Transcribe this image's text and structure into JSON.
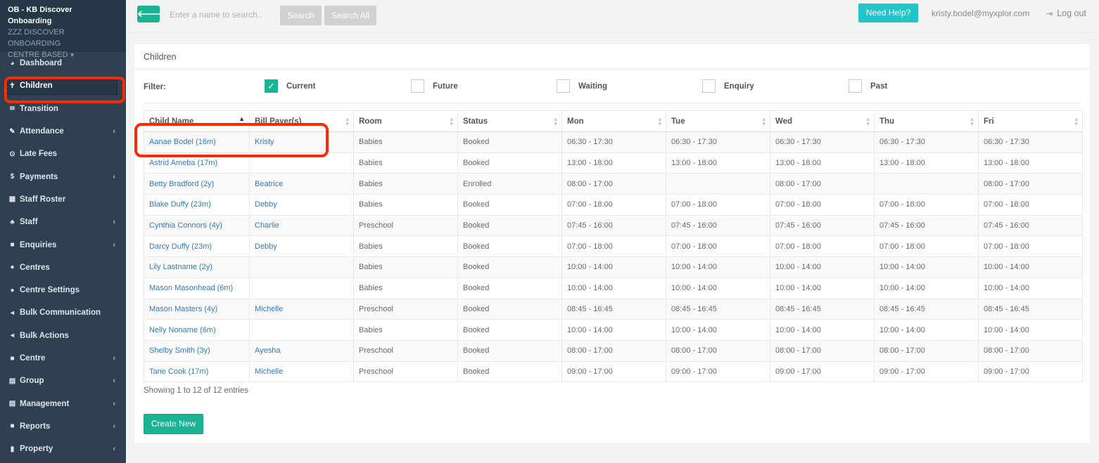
{
  "sidebar": {
    "org_name": "OB - KB Discover Onboarding",
    "centre_line1": "zzz DISCOVER ONBOARDING",
    "centre_line2": "CENTRE BASED",
    "items": [
      {
        "label": "Dashboard",
        "icon": "dashboard-icon",
        "glyph": "◕",
        "chevron": false
      },
      {
        "label": "Children",
        "icon": "child-icon",
        "glyph": "✝",
        "chevron": false,
        "active": true
      },
      {
        "label": "Transition",
        "icon": "graduation-cap-icon",
        "glyph": "≅",
        "chevron": false
      },
      {
        "label": "Attendance",
        "icon": "edit-icon",
        "glyph": "✎",
        "chevron": true
      },
      {
        "label": "Late Fees",
        "icon": "clock-icon",
        "glyph": "⊙",
        "chevron": false
      },
      {
        "label": "Payments",
        "icon": "dollar-icon",
        "glyph": "$",
        "chevron": true
      },
      {
        "label": "Staff Roster",
        "icon": "calendar-icon",
        "glyph": "▦",
        "chevron": false
      },
      {
        "label": "Staff",
        "icon": "sitemap-icon",
        "glyph": "♣",
        "chevron": true
      },
      {
        "label": "Enquiries",
        "icon": "grid-icon",
        "glyph": "■",
        "chevron": true
      },
      {
        "label": "Centres",
        "icon": "circle-icon",
        "glyph": "●",
        "chevron": false
      },
      {
        "label": "Centre Settings",
        "icon": "circle-icon",
        "glyph": "●",
        "chevron": false
      },
      {
        "label": "Bulk Communication",
        "icon": "bullhorn-icon",
        "glyph": "◂",
        "chevron": false
      },
      {
        "label": "Bulk Actions",
        "icon": "bullhorn-icon",
        "glyph": "◂",
        "chevron": false
      },
      {
        "label": "Centre",
        "icon": "grid-icon",
        "glyph": "■",
        "chevron": true
      },
      {
        "label": "Group",
        "icon": "hdd-icon",
        "glyph": "▤",
        "chevron": true
      },
      {
        "label": "Management",
        "icon": "hdd-icon",
        "glyph": "▤",
        "chevron": true
      },
      {
        "label": "Reports",
        "icon": "grid-icon",
        "glyph": "■",
        "chevron": true
      },
      {
        "label": "Property",
        "icon": "building-icon",
        "glyph": "▮",
        "chevron": true
      }
    ]
  },
  "topbar": {
    "search_placeholder": "Enter a name to search..",
    "search_label": "Search",
    "search_all_label": "Search All",
    "need_help_label": "Need Help?",
    "user_email": "kristy.bodel@myxplor.com",
    "logout_label": "Log out"
  },
  "panel": {
    "title": "Children",
    "filter_label": "Filter:",
    "filters": [
      {
        "label": "Current",
        "checked": true
      },
      {
        "label": "Future",
        "checked": false
      },
      {
        "label": "Waiting",
        "checked": false
      },
      {
        "label": "Enquiry",
        "checked": false
      },
      {
        "label": "Past",
        "checked": false
      }
    ]
  },
  "table": {
    "columns": [
      "Child Name",
      "Bill Payer(s)",
      "Room",
      "Status",
      "Mon",
      "Tue",
      "Wed",
      "Thu",
      "Fri"
    ],
    "rows": [
      [
        "Aanae Bodel (16m)",
        "Kristy",
        "Babies",
        "Booked",
        "06:30 - 17:30",
        "06:30 - 17:30",
        "06:30 - 17:30",
        "06:30 - 17:30",
        "06:30 - 17:30"
      ],
      [
        "Astrid Ameba (17m)",
        "",
        "Babies",
        "Booked",
        "13:00 - 18:00",
        "13:00 - 18:00",
        "13:00 - 18:00",
        "13:00 - 18:00",
        "13:00 - 18:00"
      ],
      [
        "Betty Bradford (2y)",
        "Beatrice",
        "Babies",
        "Enrolled",
        "08:00 - 17:00",
        "",
        "08:00 - 17:00",
        "",
        "08:00 - 17:00"
      ],
      [
        "Blake Duffy (23m)",
        "Debby",
        "Babies",
        "Booked",
        "07:00 - 18:00",
        "07:00 - 18:00",
        "07:00 - 18:00",
        "07:00 - 18:00",
        "07:00 - 18:00"
      ],
      [
        "Cynthia Connors (4y)",
        "Charlie",
        "Preschool",
        "Booked",
        "07:45 - 16:00",
        "07:45 - 16:00",
        "07:45 - 16:00",
        "07:45 - 16:00",
        "07:45 - 16:00"
      ],
      [
        "Darcy Duffy (23m)",
        "Debby",
        "Babies",
        "Booked",
        "07:00 - 18:00",
        "07:00 - 18:00",
        "07:00 - 18:00",
        "07:00 - 18:00",
        "07:00 - 18:00"
      ],
      [
        "Lily Lastname (2y)",
        "",
        "Babies",
        "Booked",
        "10:00 - 14:00",
        "10:00 - 14:00",
        "10:00 - 14:00",
        "10:00 - 14:00",
        "10:00 - 14:00"
      ],
      [
        "Mason Masonhead (6m)",
        "",
        "Babies",
        "Booked",
        "10:00 - 14:00",
        "10:00 - 14:00",
        "10:00 - 14:00",
        "10:00 - 14:00",
        "10:00 - 14:00"
      ],
      [
        "Mason Masters (4y)",
        "Michelle",
        "Preschool",
        "Booked",
        "08:45 - 16:45",
        "08:45 - 16:45",
        "08:45 - 16:45",
        "08:45 - 16:45",
        "08:45 - 16:45"
      ],
      [
        "Nelly Noname (6m)",
        "",
        "Babies",
        "Booked",
        "10:00 - 14:00",
        "10:00 - 14:00",
        "10:00 - 14:00",
        "10:00 - 14:00",
        "10:00 - 14:00"
      ],
      [
        "Shelby Smith (3y)",
        "Ayesha",
        "Preschool",
        "Booked",
        "08:00 - 17:00",
        "08:00 - 17:00",
        "08:00 - 17:00",
        "08:00 - 17:00",
        "08:00 - 17:00"
      ],
      [
        "Tane Cook (17m)",
        "Michelle",
        "Preschool",
        "Booked",
        "09:00 - 17:00",
        "09:00 - 17:00",
        "09:00 - 17:00",
        "09:00 - 17:00",
        "09:00 - 17:00"
      ]
    ],
    "showing_text": "Showing 1 to 12 of 12 entries"
  },
  "create_new_label": "Create New",
  "colors": {
    "sidebar_bg": "#2f4050",
    "accent_green": "#1ab394",
    "help_cyan": "#23c6c8",
    "link_blue": "#337ab7",
    "highlight_red": "#ff2a00"
  }
}
